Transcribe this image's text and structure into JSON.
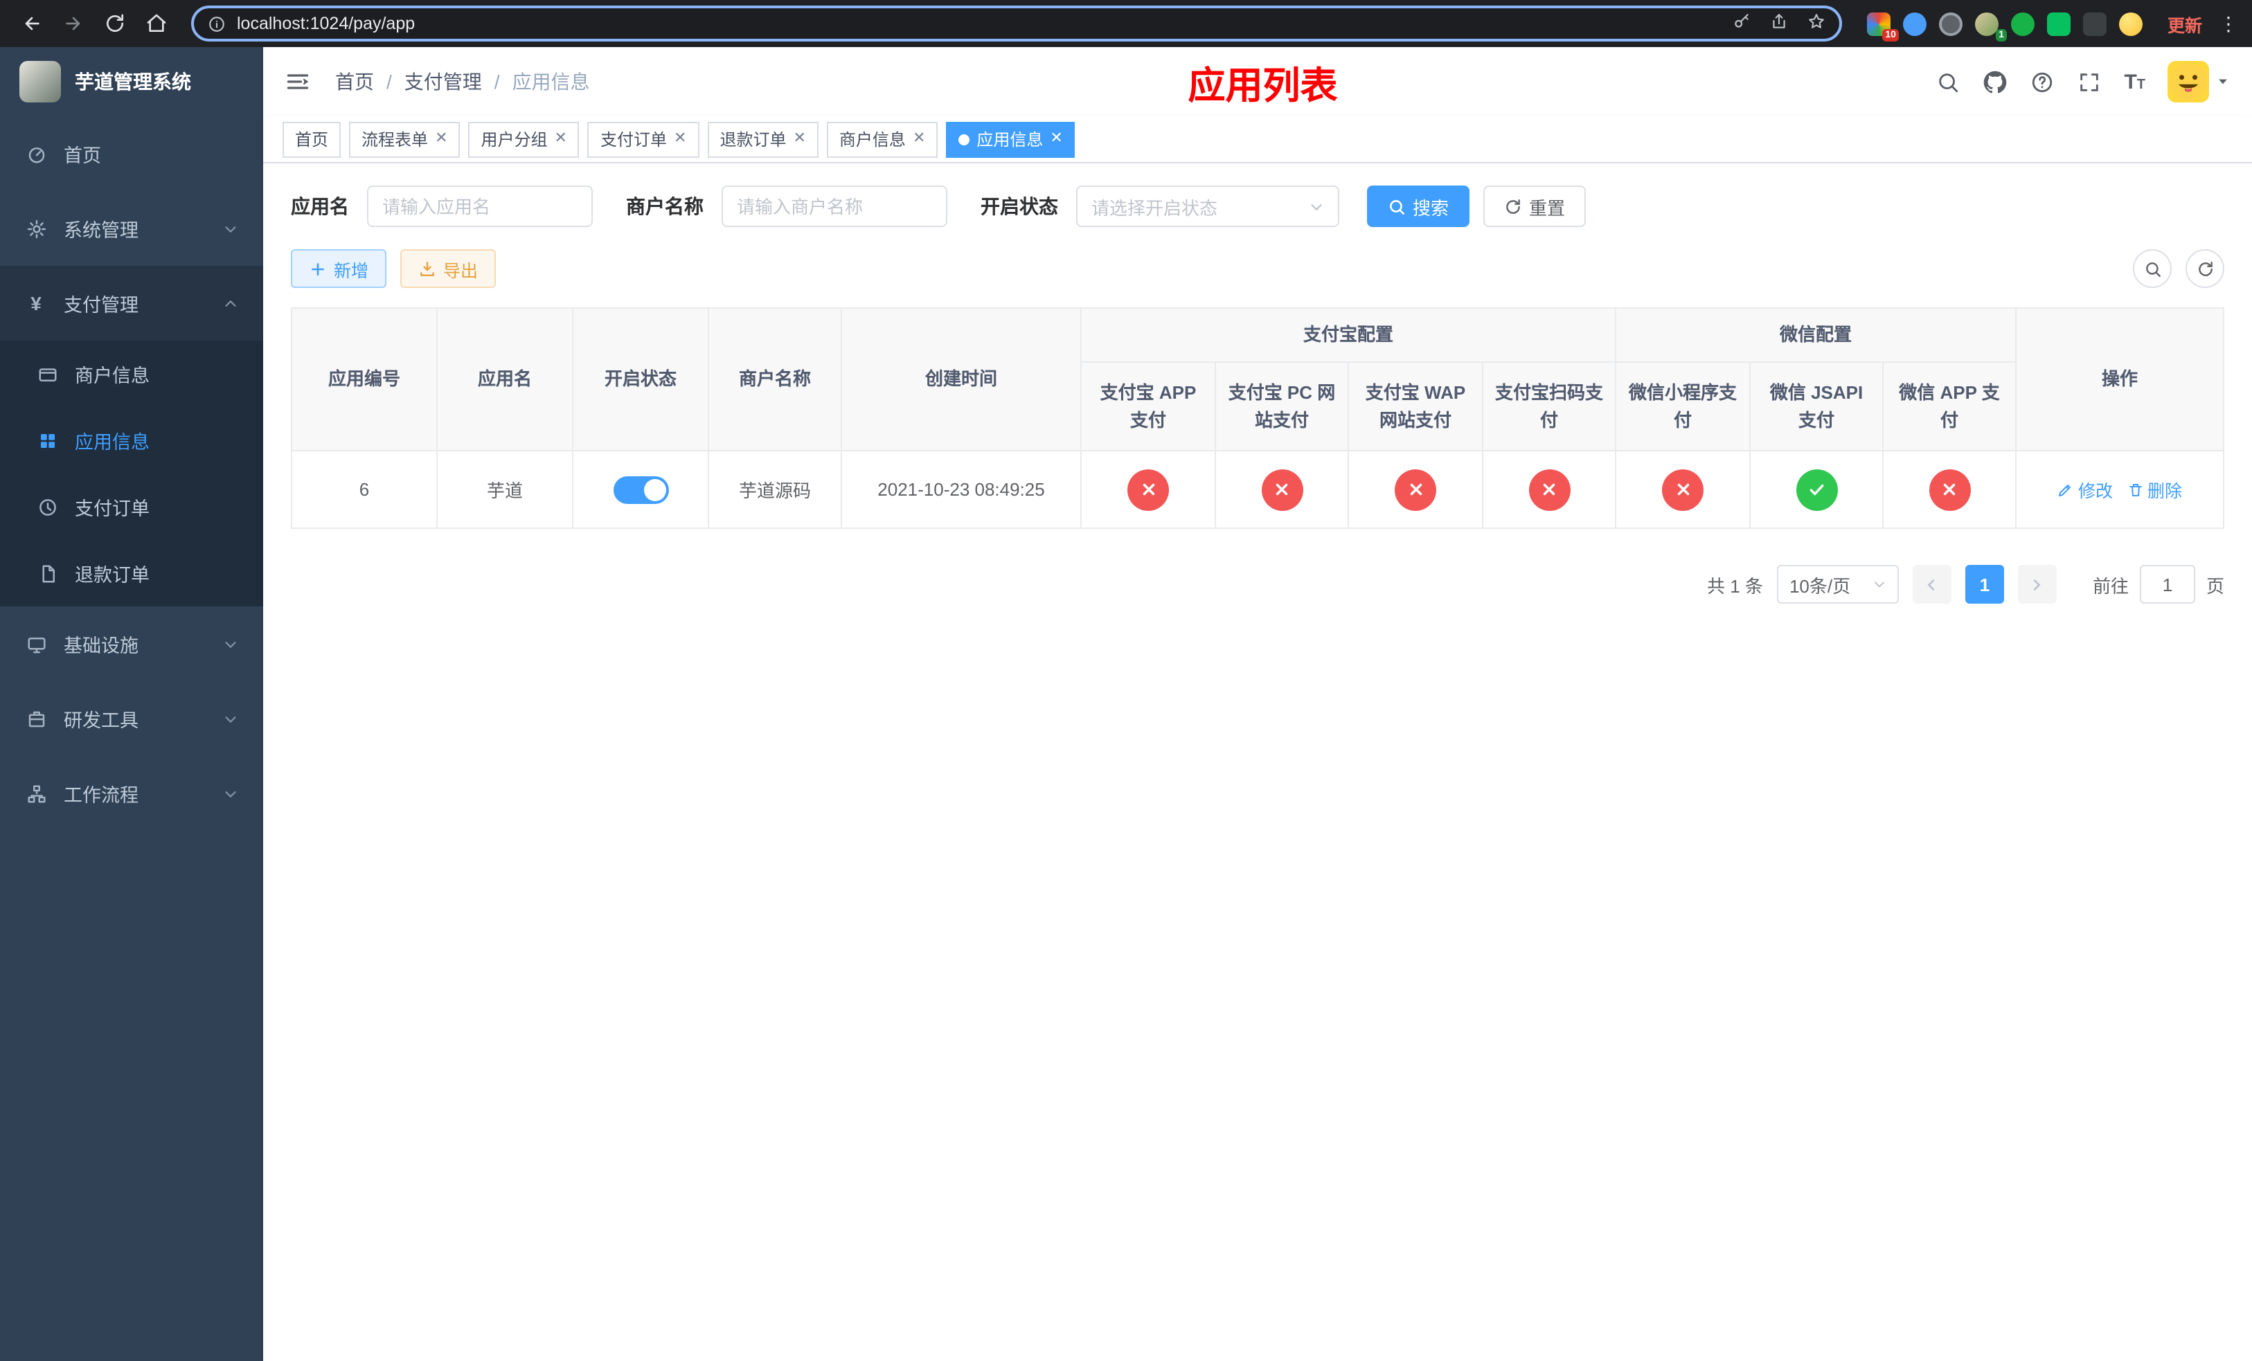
{
  "browser": {
    "url": "localhost:1024/pay/app",
    "update_label": "更新",
    "ext_badge_apps": "10",
    "ext_badge_avatar": "1"
  },
  "sidebar": {
    "title": "芋道管理系统",
    "items": [
      {
        "label": "首页"
      },
      {
        "label": "系统管理"
      },
      {
        "label": "支付管理"
      },
      {
        "label": "基础设施"
      },
      {
        "label": "研发工具"
      },
      {
        "label": "工作流程"
      }
    ],
    "submenu": [
      {
        "label": "商户信息"
      },
      {
        "label": "应用信息"
      },
      {
        "label": "支付订单"
      },
      {
        "label": "退款订单"
      }
    ]
  },
  "header": {
    "breadcrumb": [
      "首页",
      "支付管理",
      "应用信息"
    ],
    "title": "应用列表"
  },
  "tabs": [
    {
      "label": "首页"
    },
    {
      "label": "流程表单"
    },
    {
      "label": "用户分组"
    },
    {
      "label": "支付订单"
    },
    {
      "label": "退款订单"
    },
    {
      "label": "商户信息"
    },
    {
      "label": "应用信息"
    }
  ],
  "filters": {
    "app_name_label": "应用名",
    "app_name_placeholder": "请输入应用名",
    "merchant_label": "商户名称",
    "merchant_placeholder": "请输入商户名称",
    "status_label": "开启状态",
    "status_placeholder": "请选择开启状态",
    "search_label": "搜索",
    "reset_label": "重置"
  },
  "toolbar": {
    "add_label": "新增",
    "export_label": "导出"
  },
  "table": {
    "col_id": "应用编号",
    "col_name": "应用名",
    "col_status": "开启状态",
    "col_merchant": "商户名称",
    "col_created": "创建时间",
    "group_alipay": "支付宝配置",
    "group_wechat": "微信配置",
    "col_alipay_app": "支付宝 APP 支付",
    "col_alipay_pc": "支付宝 PC 网站支付",
    "col_alipay_wap": "支付宝 WAP 网站支付",
    "col_alipay_qr": "支付宝扫码支付",
    "col_wx_mini": "微信小程序支付",
    "col_wx_jsapi": "微信 JSAPI 支付",
    "col_wx_app": "微信 APP 支付",
    "col_actions": "操作",
    "row": {
      "id": "6",
      "name": "芋道",
      "enabled": true,
      "merchant": "芋道源码",
      "created": "2021-10-23 08:49:25",
      "configs": [
        "no",
        "no",
        "no",
        "no",
        "no",
        "yes",
        "no"
      ],
      "edit_label": "修改",
      "delete_label": "删除"
    }
  },
  "pagination": {
    "total": "共 1 条",
    "page_size": "10条/页",
    "current_page": "1",
    "goto_label": "前往",
    "goto_value": "1",
    "unit_label": "页"
  },
  "colors": {
    "accent": "#409eff",
    "title_red": "#ff0000",
    "status_no": "#f35555",
    "status_yes": "#2fc750",
    "sidebar_bg": "#304156",
    "submenu_bg": "#1f2d3d"
  }
}
